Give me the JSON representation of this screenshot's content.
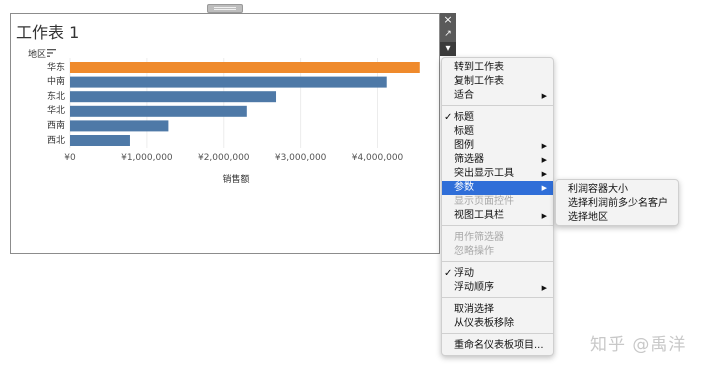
{
  "sheet": {
    "title": "工作表 1",
    "axis_field": "地区"
  },
  "chart_data": {
    "type": "bar",
    "orientation": "horizontal",
    "categories": [
      "华东",
      "中南",
      "东北",
      "华北",
      "西南",
      "西北"
    ],
    "values": [
      4550000,
      4120000,
      2680000,
      2300000,
      1280000,
      780000
    ],
    "bar_colors": [
      "#ef8a2c",
      "#4e79a7",
      "#4e79a7",
      "#4e79a7",
      "#4e79a7",
      "#4e79a7"
    ],
    "highlight_color": "#ef8a2c",
    "bar_color": "#4e79a7",
    "x_ticks": [
      "¥0",
      "¥1,000,000",
      "¥2,000,000",
      "¥3,000,000",
      "¥4,000,000"
    ],
    "x_tick_values": [
      0,
      1000000,
      2000000,
      3000000,
      4000000
    ],
    "xlabel": "销售额",
    "xlim": [
      0,
      4800000
    ],
    "grid": true
  },
  "tools": {
    "close": "×",
    "popout": "↗",
    "dropdown": "▾"
  },
  "menu": {
    "items": [
      {
        "label": "转到工作表"
      },
      {
        "label": "复制工作表"
      },
      {
        "label": "适合",
        "submenu": true
      },
      {
        "label": "标题",
        "checked": true
      },
      {
        "label": "标题"
      },
      {
        "label": "图例",
        "submenu": true
      },
      {
        "label": "筛选器",
        "submenu": true
      },
      {
        "label": "突出显示工具",
        "submenu": true
      },
      {
        "label": "参数",
        "submenu": true,
        "active": true
      },
      {
        "label": "显示页面控件",
        "disabled": true
      },
      {
        "label": "视图工具栏",
        "submenu": true
      },
      {
        "label": "用作筛选器",
        "disabled": true
      },
      {
        "label": "忽略操作",
        "disabled": true
      },
      {
        "label": "浮动",
        "checked": true
      },
      {
        "label": "浮动顺序",
        "submenu": true
      },
      {
        "label": "取消选择"
      },
      {
        "label": "从仪表板移除"
      },
      {
        "label": "重命名仪表板项目..."
      }
    ],
    "check_glyph": "✓",
    "arrow_glyph": "▶"
  },
  "submenu": {
    "items": [
      {
        "label": "利润容器大小"
      },
      {
        "label": "选择利润前多少名客户"
      },
      {
        "label": "选择地区"
      }
    ]
  },
  "watermark": "知乎 @禹洋"
}
